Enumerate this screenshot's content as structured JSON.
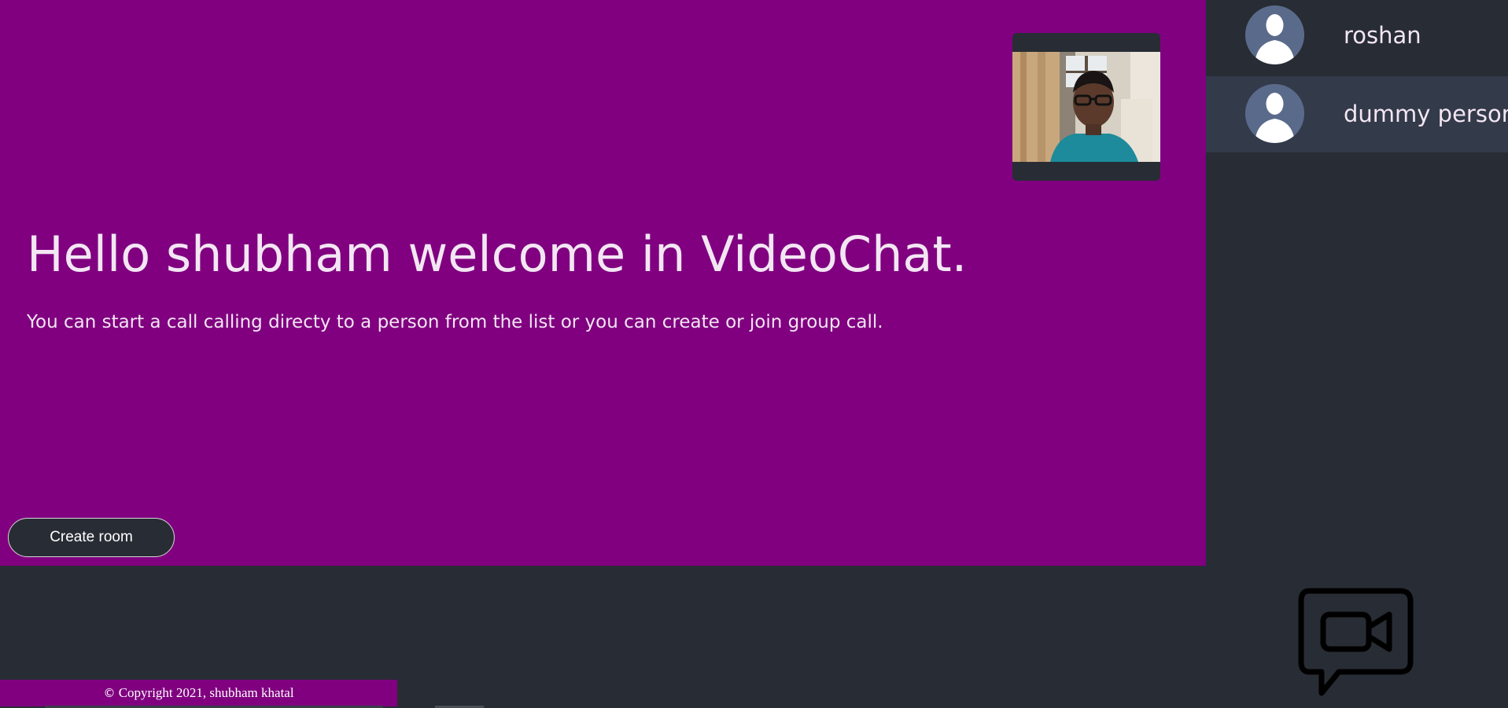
{
  "dashboard": {
    "welcome_title": "Hello shubham welcome in VideoChat.",
    "welcome_description": "You can start a call calling directy to a person from the list or you can create or join group call.",
    "create_room_label": "Create room"
  },
  "active_users": [
    {
      "username": "roshan"
    },
    {
      "username": "dummy person"
    }
  ],
  "footer": {
    "copyright_symbol": "©",
    "copyright_text": "Copyright 2021, shubham khatal"
  },
  "colors": {
    "accent": "#800080",
    "background": "#282c34",
    "list_item_alt": "#333a4a",
    "avatar": "#5a6a8a"
  },
  "icons": {
    "avatar": "user-silhouette-icon",
    "logo": "video-chat-bubble-icon"
  }
}
